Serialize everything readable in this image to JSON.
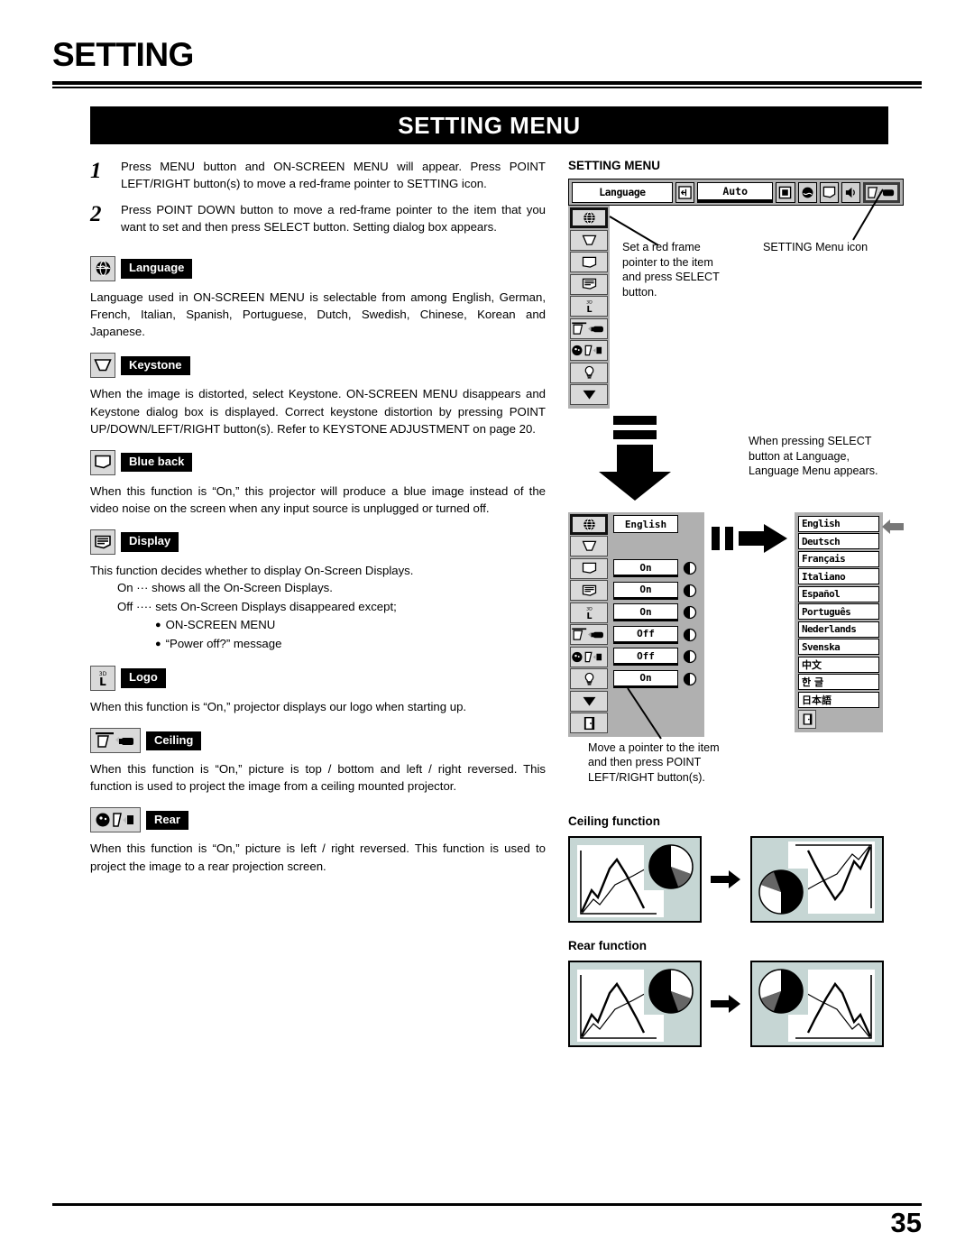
{
  "page": {
    "chapter_title": "SETTING",
    "banner_title": "SETTING MENU",
    "page_number": "35"
  },
  "steps": [
    {
      "num": "1",
      "text": "Press MENU button and ON-SCREEN MENU will appear.  Press POINT LEFT/RIGHT button(s) to move a red-frame pointer to SETTING icon."
    },
    {
      "num": "2",
      "text": "Press POINT DOWN button to move a red-frame pointer to the item that you want to set and then press SELECT button.  Setting dialog box appears."
    }
  ],
  "sections": [
    {
      "id": "language",
      "label": "Language",
      "icon": "globe-icon",
      "text": "Language used in ON-SCREEN MENU is selectable from among English, German, French, Italian, Spanish, Portuguese, Dutch, Swedish, Chinese, Korean and Japanese."
    },
    {
      "id": "keystone",
      "label": "Keystone",
      "icon": "keystone-icon",
      "text": "When the image is distorted, select Keystone.  ON-SCREEN MENU disappears and Keystone dialog box is displayed.  Correct keystone distortion by pressing POINT UP/DOWN/LEFT/RIGHT button(s). Refer to KEYSTONE ADJUSTMENT on page 20."
    },
    {
      "id": "blue-back",
      "label": "Blue back",
      "icon": "blue-back-icon",
      "text": "When this function is “On,” this projector will produce a blue image instead of the video noise on the screen when any input source is unplugged or turned off."
    },
    {
      "id": "display",
      "label": "Display",
      "icon": "display-icon",
      "text": "This function decides whether to display On-Screen Displays.",
      "sub_lines": [
        "On  ··· shows all the On-Screen Displays.",
        "Off ···· sets On-Screen Displays disappeared except;"
      ],
      "bullets": [
        "ON-SCREEN MENU",
        "“Power off?” message"
      ]
    },
    {
      "id": "logo",
      "label": "Logo",
      "icon": "logo-icon",
      "text": "When this function is “On,” projector displays our logo when starting up."
    },
    {
      "id": "ceiling",
      "label": "Ceiling",
      "icon": "ceiling-icon",
      "text": "When this function is “On,” picture is top / bottom and left / right reversed.  This function is used to project the image from a ceiling mounted projector."
    },
    {
      "id": "rear",
      "label": "Rear",
      "icon": "rear-icon",
      "text": "When this function is “On,” picture is left / right reversed.  This function is used to project the image to a rear projection screen."
    }
  ],
  "osd": {
    "menu_heading": "SETTING MENU",
    "menu_bar": {
      "title": "Language",
      "auto_label": "Auto",
      "buttons": [
        "input-icon",
        "screen-icon",
        "image-icon",
        "pc-adjust-icon",
        "sound-icon",
        "setting-icon"
      ]
    },
    "rail_icons": [
      "globe-icon",
      "keystone-icon",
      "blue-back-icon",
      "display-icon",
      "logo-icon",
      "ceiling-icon",
      "rear-icon",
      "lamp-icon",
      "down-arrow-icon"
    ],
    "dialog_rows": [
      {
        "icon": "globe-icon",
        "value": "English",
        "has_adjust": false
      },
      {
        "icon": "keystone-icon",
        "value": "",
        "has_adjust": false
      },
      {
        "icon": "blue-back-icon",
        "value": "On",
        "has_adjust": true
      },
      {
        "icon": "display-icon",
        "value": "On",
        "has_adjust": true
      },
      {
        "icon": "logo-icon",
        "value": "On",
        "has_adjust": true
      },
      {
        "icon": "ceiling-icon",
        "value": "Off",
        "has_adjust": true
      },
      {
        "icon": "rear-icon",
        "value": "Off",
        "has_adjust": true
      },
      {
        "icon": "lamp-icon",
        "value": "On",
        "has_adjust": true
      }
    ],
    "language_options": [
      "English",
      "Deutsch",
      "Français",
      "Italiano",
      "Español",
      "Português",
      "Nederlands",
      "Svenska",
      "中文",
      "한 글",
      "日本語"
    ]
  },
  "callouts": {
    "red_frame": "Set a red frame\npointer to the item\nand press SELECT\nbutton.",
    "red_frame_l1": "Set a red frame",
    "red_frame_l2": "pointer to the item",
    "red_frame_l3": "and press SELECT",
    "red_frame_l4": "button.",
    "setting_menu_icon": "SETTING Menu icon",
    "select_l1": "When pressing SELECT",
    "select_l2": "button at Language,",
    "select_l3": "Language Menu appears.",
    "move_l1": "Move a pointer to the item",
    "move_l2": "and then press POINT",
    "move_l3": "LEFT/RIGHT button(s)."
  },
  "figures": {
    "ceiling_title": "Ceiling function",
    "rear_title": "Rear function"
  },
  "colors": {
    "banner_bg": "#000000",
    "osd_gray": "#b0b0b0",
    "chip_gray": "#d9d9d9",
    "proj_teal": "#c6d6d4"
  }
}
